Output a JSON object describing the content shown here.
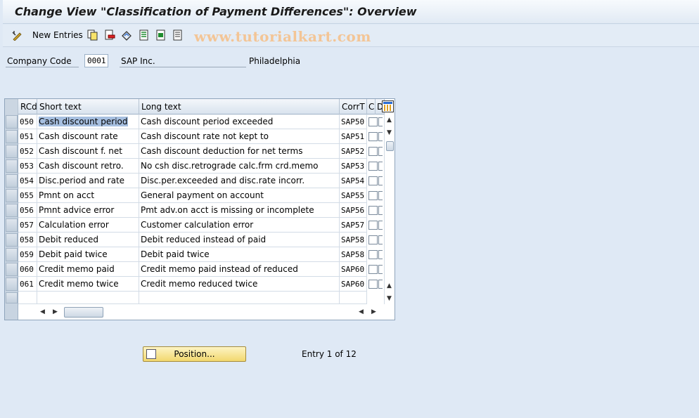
{
  "title": "Change View \"Classification of Payment Differences\": Overview",
  "toolbar": {
    "new_entries_label": "New Entries",
    "watermark": "www.tutorialkart.com"
  },
  "header_fields": {
    "company_code_label": "Company Code",
    "company_code_value": "0001",
    "company_name": "SAP Inc.",
    "city": "Philadelphia"
  },
  "table": {
    "columns": [
      "RCd",
      "Short text",
      "Long text",
      "CorrT",
      "C",
      "D"
    ],
    "rows": [
      {
        "rcd": "050",
        "short": "Cash discount period",
        "long": "Cash discount period exceeded",
        "corrt": "SAP50"
      },
      {
        "rcd": "051",
        "short": "Cash discount rate",
        "long": "Cash discount rate not kept to",
        "corrt": "SAP51"
      },
      {
        "rcd": "052",
        "short": "Cash discount f. net",
        "long": "Cash discount deduction for net terms",
        "corrt": "SAP52"
      },
      {
        "rcd": "053",
        "short": "Cash discount retro.",
        "long": "No csh disc.retrograde calc.frm crd.memo",
        "corrt": "SAP53"
      },
      {
        "rcd": "054",
        "short": "Disc.period and rate",
        "long": "Disc.per.exceeded and disc.rate incorr.",
        "corrt": "SAP54"
      },
      {
        "rcd": "055",
        "short": "Pmnt on acct",
        "long": "General payment on account",
        "corrt": "SAP55"
      },
      {
        "rcd": "056",
        "short": "Pmnt advice error",
        "long": "Pmt adv.on acct is missing or incomplete",
        "corrt": "SAP56"
      },
      {
        "rcd": "057",
        "short": "Calculation error",
        "long": "Customer calculation error",
        "corrt": "SAP57"
      },
      {
        "rcd": "058",
        "short": "Debit reduced",
        "long": "Debit reduced instead of paid",
        "corrt": "SAP58"
      },
      {
        "rcd": "059",
        "short": "Debit paid twice",
        "long": "Debit paid twice",
        "corrt": "SAP58"
      },
      {
        "rcd": "060",
        "short": "Credit memo paid",
        "long": "Credit memo paid instead of reduced",
        "corrt": "SAP60"
      },
      {
        "rcd": "061",
        "short": "Credit memo twice",
        "long": "Credit memo reduced twice",
        "corrt": "SAP60"
      }
    ]
  },
  "position_button_label": "Position...",
  "entry_info": "Entry 1 of 12",
  "colors": {
    "background": "#dfe9f5",
    "highlight": "#a6bfe0",
    "button": "#f2d86e"
  }
}
